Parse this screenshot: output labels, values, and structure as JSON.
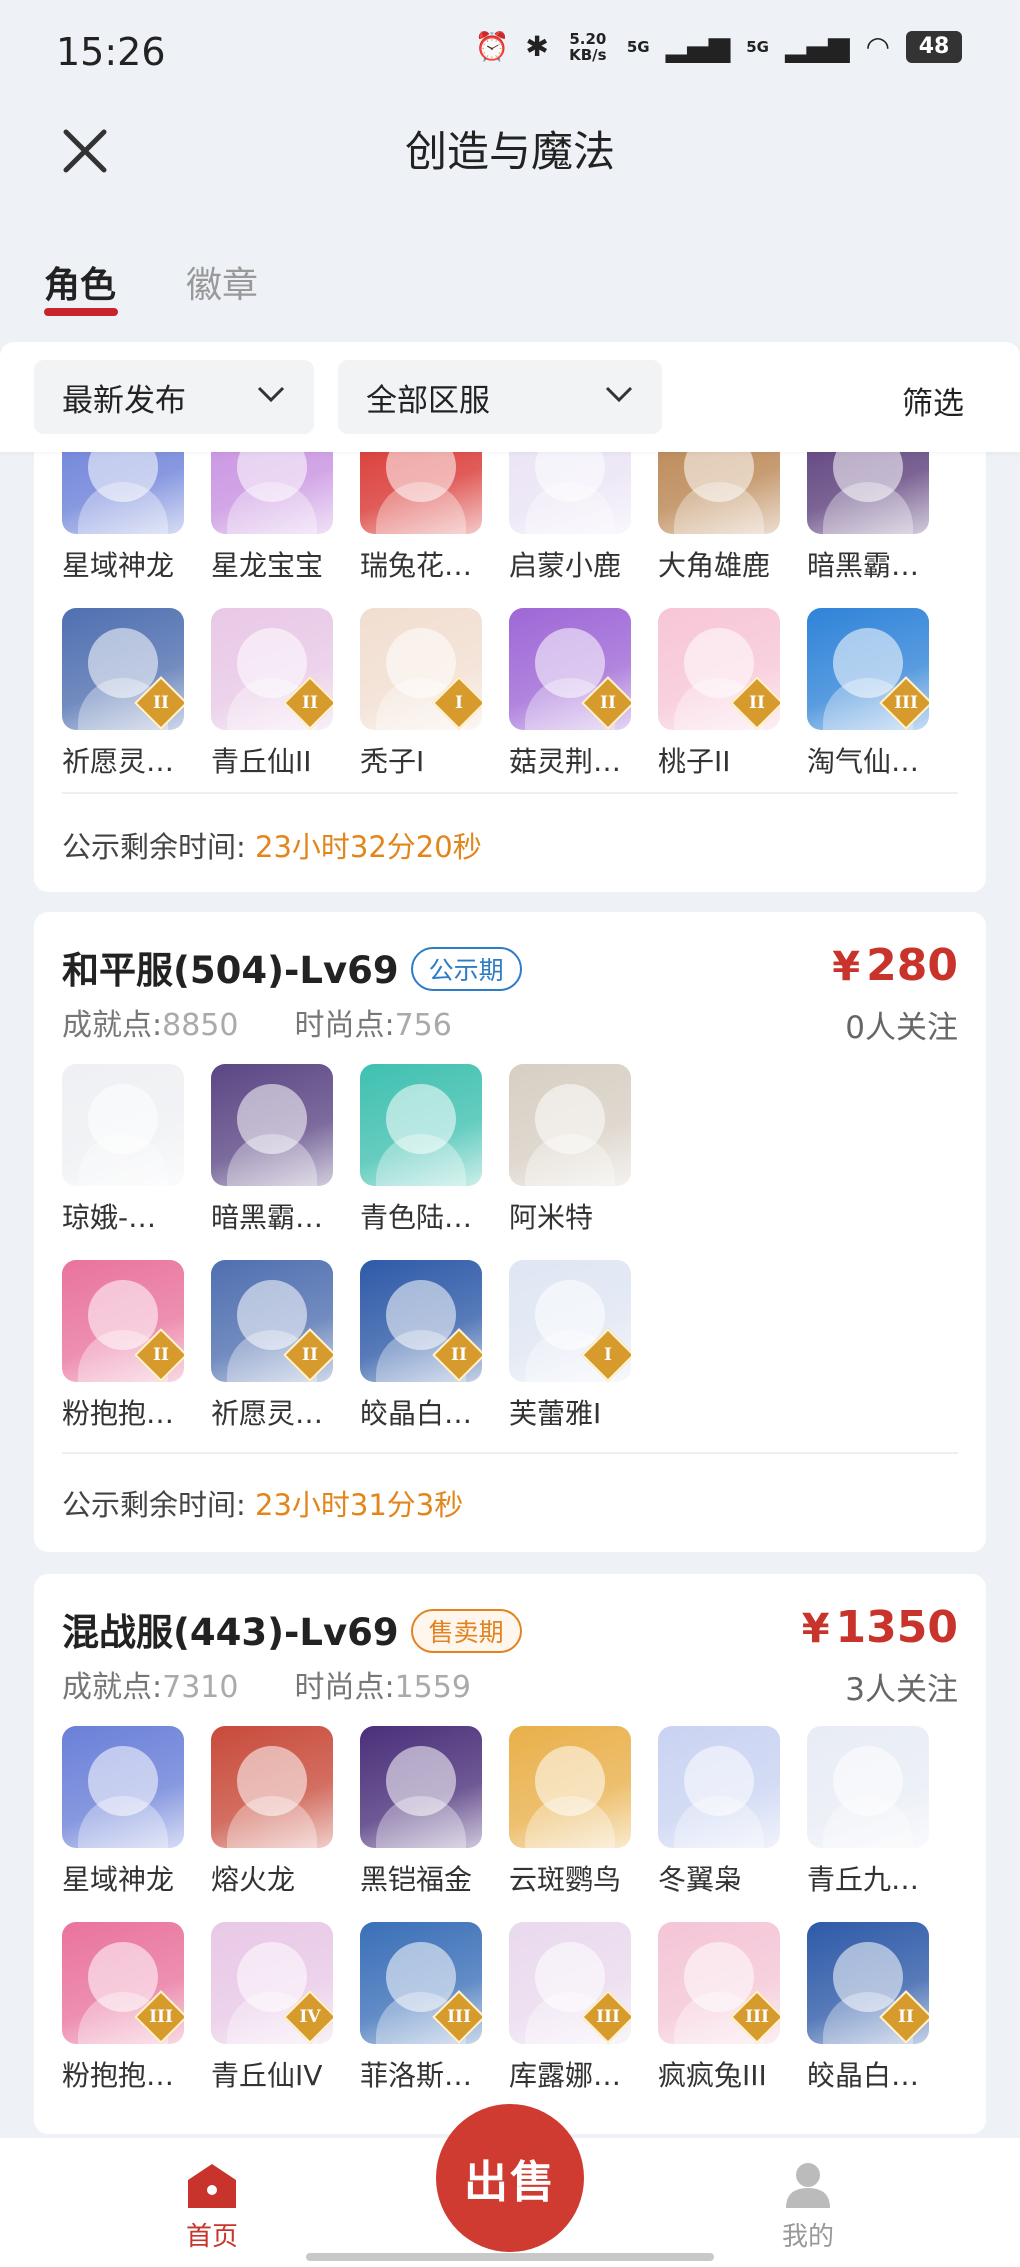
{
  "status": {
    "time": "15:26",
    "speed": "5.20 KB/s",
    "net1": "5G",
    "net2": "5G",
    "battery": "48"
  },
  "header": {
    "title": "创造与魔法"
  },
  "tabs": [
    {
      "label": "角色"
    },
    {
      "label": "徽章"
    }
  ],
  "filters": {
    "sort": "最新发布",
    "server": "全部区服",
    "filter": "筛选"
  },
  "listings": [
    {
      "items_row1": [
        {
          "name": "星域神龙",
          "color": "#6a7fd8"
        },
        {
          "name": "星龙宝宝",
          "color": "#c790e0"
        },
        {
          "name": "瑞兔花…",
          "color": "#d8332f"
        },
        {
          "name": "启蒙小鹿",
          "color": "#e9e2f4"
        },
        {
          "name": "大角雄鹿",
          "color": "#b9844f"
        },
        {
          "name": "暗黑霸…",
          "color": "#5a3d7a"
        }
      ],
      "items_row2": [
        {
          "name": "祈愿灵…",
          "color": "#4f6fb0",
          "rank": "II"
        },
        {
          "name": "青丘仙II",
          "color": "#e8c8e6",
          "rank": "II"
        },
        {
          "name": "秃子I",
          "color": "#f1ded0",
          "rank": "I"
        },
        {
          "name": "菇灵荆…",
          "color": "#9e67d6",
          "rank": "II"
        },
        {
          "name": "桃子II",
          "color": "#f7c6d6",
          "rank": "II"
        },
        {
          "name": "淘气仙…",
          "color": "#2f83d8",
          "rank": "III"
        }
      ],
      "countdown_label": "公示剩余时间:",
      "countdown_time": "23小时32分20秒"
    },
    {
      "name": "和平服(504)-Lv69",
      "badge": "公示期",
      "achievement_label": "成就点:",
      "achievement": "8850",
      "fashion_label": "时尚点:",
      "fashion": "756",
      "price_symbol": "¥",
      "price": "280",
      "followers": "0人关注",
      "items_row1": [
        {
          "name": "琼娥-…",
          "color": "#eef0f3"
        },
        {
          "name": "暗黑霸…",
          "color": "#5b4684"
        },
        {
          "name": "青色陆…",
          "color": "#3fc0b0"
        },
        {
          "name": "阿米特",
          "color": "#d7cfc3"
        }
      ],
      "items_row2": [
        {
          "name": "粉抱抱…",
          "color": "#e9739e",
          "rank": "II"
        },
        {
          "name": "祈愿灵…",
          "color": "#4f6fb0",
          "rank": "II"
        },
        {
          "name": "皎晶白…",
          "color": "#2e5aa8",
          "rank": "II"
        },
        {
          "name": "芙蕾雅I",
          "color": "#dfe6f3",
          "rank": "I"
        }
      ],
      "countdown_label": "公示剩余时间:",
      "countdown_time": "23小时31分3秒"
    },
    {
      "name": "混战服(443)-Lv69",
      "badge": "售卖期",
      "achievement_label": "成就点:",
      "achievement": "7310",
      "fashion_label": "时尚点:",
      "fashion": "1559",
      "price_symbol": "¥",
      "price": "1350",
      "followers": "3人关注",
      "items_row1": [
        {
          "name": "星域神龙",
          "color": "#6a7fd8"
        },
        {
          "name": "熔火龙",
          "color": "#c84a3a"
        },
        {
          "name": "黑铠福金",
          "color": "#4a2f7a"
        },
        {
          "name": "云斑鹦鸟",
          "color": "#e9b04a"
        },
        {
          "name": "冬翼枭",
          "color": "#c9d3f2"
        },
        {
          "name": "青丘九…",
          "color": "#e8ecf5"
        }
      ],
      "items_row2": [
        {
          "name": "粉抱抱…",
          "color": "#e9739e",
          "rank": "III"
        },
        {
          "name": "青丘仙IV",
          "color": "#e8c8e6",
          "rank": "IV"
        },
        {
          "name": "菲洛斯…",
          "color": "#3a6fb8",
          "rank": "III"
        },
        {
          "name": "库露娜…",
          "color": "#ead9ee",
          "rank": "III"
        },
        {
          "name": "疯疯兔III",
          "color": "#f4c5d6",
          "rank": "III"
        },
        {
          "name": "皎晶白…",
          "color": "#2e5aa8",
          "rank": "II"
        }
      ]
    }
  ],
  "bottom_nav": {
    "home": "首页",
    "sell": "出售",
    "mine": "我的"
  }
}
